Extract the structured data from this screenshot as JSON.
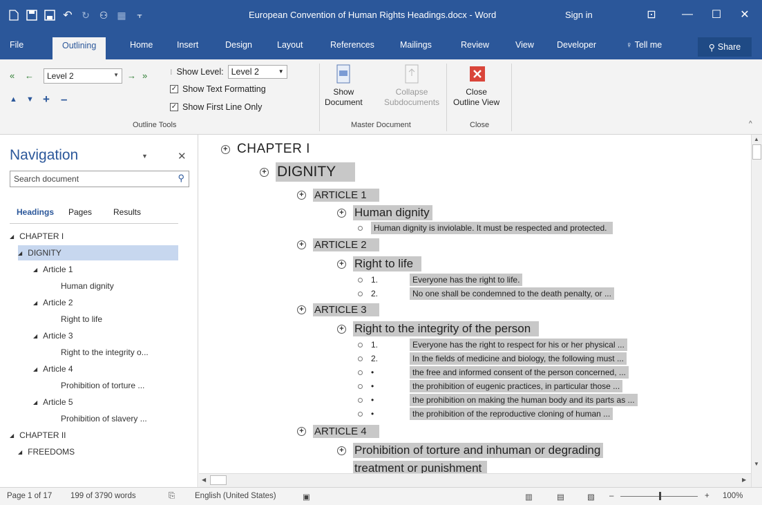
{
  "window": {
    "title": "European Convention of Human Rights Headings.docx - Word",
    "sign_in": "Sign in"
  },
  "tabs": [
    {
      "label": "File"
    },
    {
      "label": "Outlining"
    },
    {
      "label": "Home"
    },
    {
      "label": "Insert"
    },
    {
      "label": "Design"
    },
    {
      "label": "Layout"
    },
    {
      "label": "References"
    },
    {
      "label": "Mailings"
    },
    {
      "label": "Review"
    },
    {
      "label": "View"
    },
    {
      "label": "Developer"
    },
    {
      "label": "Tell me"
    }
  ],
  "share_label": "Share",
  "ribbon": {
    "level_value": "Level 2",
    "show_level_label": "Show Level:",
    "show_level_value": "Level 2",
    "show_text_formatting": "Show Text Formatting",
    "show_first_line_only": "Show First Line Only",
    "outline_tools_label": "Outline Tools",
    "show_document_1": "Show",
    "show_document_2": "Document",
    "collapse_1": "Collapse",
    "collapse_2": "Subdocuments",
    "master_document_label": "Master Document",
    "close_1": "Close",
    "close_2": "Outline View",
    "close_group_label": "Close"
  },
  "nav": {
    "title": "Navigation",
    "search_placeholder": "Search document",
    "tabs": [
      "Headings",
      "Pages",
      "Results"
    ],
    "tree": [
      {
        "label": "CHAPTER I",
        "tri": "◢"
      },
      {
        "label": "DIGNITY",
        "tri": "◢",
        "selected": true
      },
      {
        "label": "Article 1",
        "tri": "◢"
      },
      {
        "label": "Human dignity",
        "tri": ""
      },
      {
        "label": "Article 2",
        "tri": "◢"
      },
      {
        "label": "Right to life",
        "tri": ""
      },
      {
        "label": "Article 3",
        "tri": "◢"
      },
      {
        "label": "Right to the integrity o...",
        "tri": ""
      },
      {
        "label": "Article 4",
        "tri": "◢"
      },
      {
        "label": "Prohibition of torture ...",
        "tri": ""
      },
      {
        "label": "Article 5",
        "tri": "◢"
      },
      {
        "label": "Prohibition of slavery ...",
        "tri": ""
      },
      {
        "label": "CHAPTER II",
        "tri": "◢"
      },
      {
        "label": "FREEDOMS",
        "tri": "◢"
      }
    ]
  },
  "outline": {
    "chapter1": "CHAPTER I",
    "dignity": "DIGNITY",
    "article1": "ARTICLE 1",
    "human_dignity": "Human dignity",
    "hd_text": "Human dignity is inviolable. It must be respected and protected.",
    "article2": "ARTICLE 2",
    "right_to_life": "Right to life",
    "rl_1_num": "1.",
    "rl_1_text": "Everyone has the right to life.",
    "rl_2_num": "2.",
    "rl_2_text": "No one shall be condemned to the death penalty, or ...",
    "article3": "ARTICLE 3",
    "integrity": "Right to the integrity of the person",
    "in_1_num": "1.",
    "in_1_text": "Everyone has the right to respect for his or her physical ...",
    "in_2_num": "2.",
    "in_2_text": "In the fields of medicine and biology, the following must ...",
    "in_3_text": "the free and informed consent of the person concerned, ...",
    "in_4_text": "the prohibition of eugenic practices, in particular those ...",
    "in_5_text": "the prohibition on making the human body and its parts as ...",
    "in_6_text": "the prohibition of the reproductive cloning of human ...",
    "bullet": "•",
    "article4": "ARTICLE 4",
    "torture_1": "Prohibition of torture and inhuman or degrading",
    "torture_2": "treatment or punishment"
  },
  "status": {
    "page": "Page 1 of 17",
    "words": "199 of 3790 words",
    "language": "English (United States)",
    "zoom": "100%"
  }
}
